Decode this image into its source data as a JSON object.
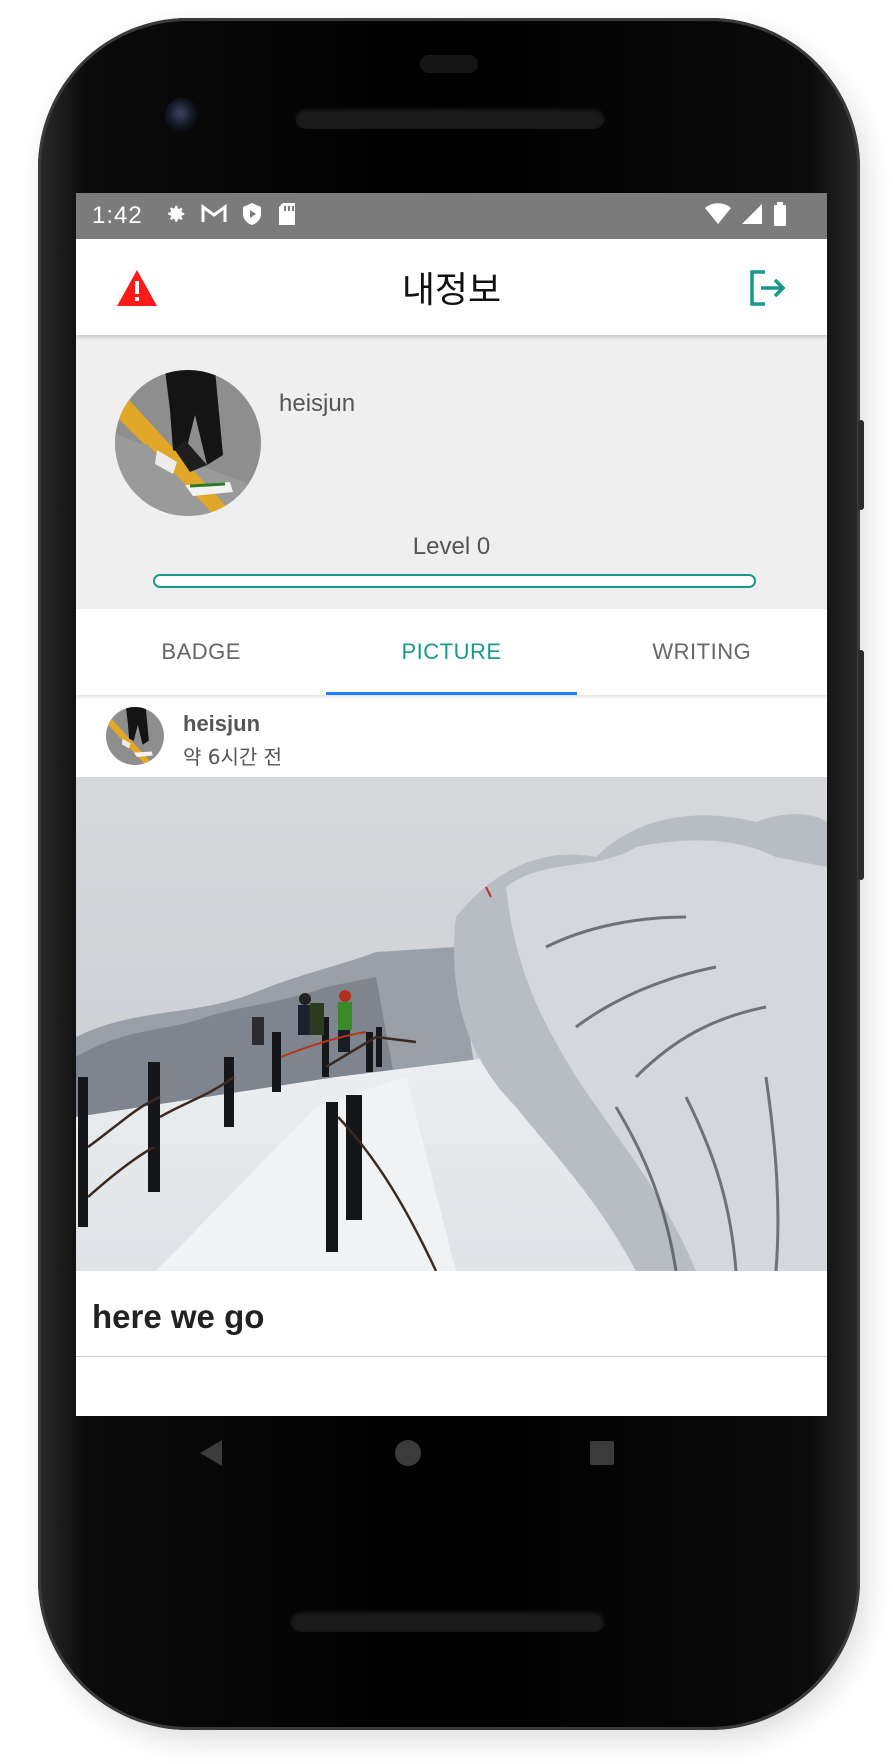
{
  "status_bar": {
    "time": "1:42",
    "left_icons": [
      "gear-icon",
      "gmail-icon",
      "shield-play-icon",
      "sd-card-icon"
    ],
    "right_icons": [
      "wifi-icon",
      "signal-icon",
      "battery-icon"
    ]
  },
  "app_bar": {
    "title": "내정보",
    "left_icon": "warning-icon",
    "right_icon": "logout-icon",
    "colors": {
      "warning": "#ff1a1a",
      "logout": "#169b8b"
    }
  },
  "profile": {
    "username": "heisjun",
    "level_label": "Level 0",
    "level_progress": 0
  },
  "tabs": [
    {
      "label": "BADGE",
      "active": false
    },
    {
      "label": "PICTURE",
      "active": true
    },
    {
      "label": "WRITING",
      "active": false
    }
  ],
  "post": {
    "author": "heisjun",
    "time_ago": "약 6시간 전",
    "title": "here we go",
    "image_alt": "snowy mountain trail"
  },
  "nav_bar": [
    "back-icon",
    "home-icon",
    "recents-icon"
  ],
  "colors": {
    "accent": "#169b8b",
    "tab_indicator": "#1f7ff0",
    "status_bar": "#7b7b7b"
  }
}
